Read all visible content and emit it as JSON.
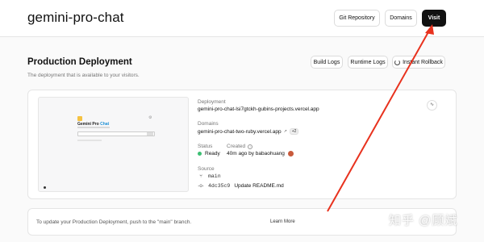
{
  "header": {
    "project_title": "gemini-pro-chat",
    "git_repository_label": "Git Repository",
    "domains_label": "Domains",
    "visit_label": "Visit"
  },
  "production": {
    "title": "Production Deployment",
    "subtitle": "The deployment that is available to your visitors.",
    "build_logs_label": "Build Logs",
    "runtime_logs_label": "Runtime Logs",
    "instant_rollback_label": "Instant Rollback"
  },
  "preview": {
    "title_main": "Gemini Pro",
    "title_accent": "Chat"
  },
  "deployment": {
    "deployment_label": "Deployment",
    "deployment_url": "gemini-pro-chat-lsi7gtckh-gubins-projects.vercel.app",
    "domains_label": "Domains",
    "domain_url": "gemini-pro-chat-two-ruby.vercel.app",
    "extra_domains_badge": "+2",
    "status_label": "Status",
    "status_value": "Ready",
    "created_label": "Created",
    "created_value": "40m ago by babaohuang",
    "source_label": "Source",
    "branch": "main",
    "commit_hash": "4dc35c9",
    "commit_message": "Update README.md"
  },
  "notice": {
    "text": "To update your Production Deployment, push to the \"main\" branch.",
    "learn_more": "Learn More"
  },
  "watermark": "知乎 @顾斌",
  "colors": {
    "ready": "#3cbf73",
    "arrow": "#e8321e",
    "accent": "#1e90d6"
  }
}
